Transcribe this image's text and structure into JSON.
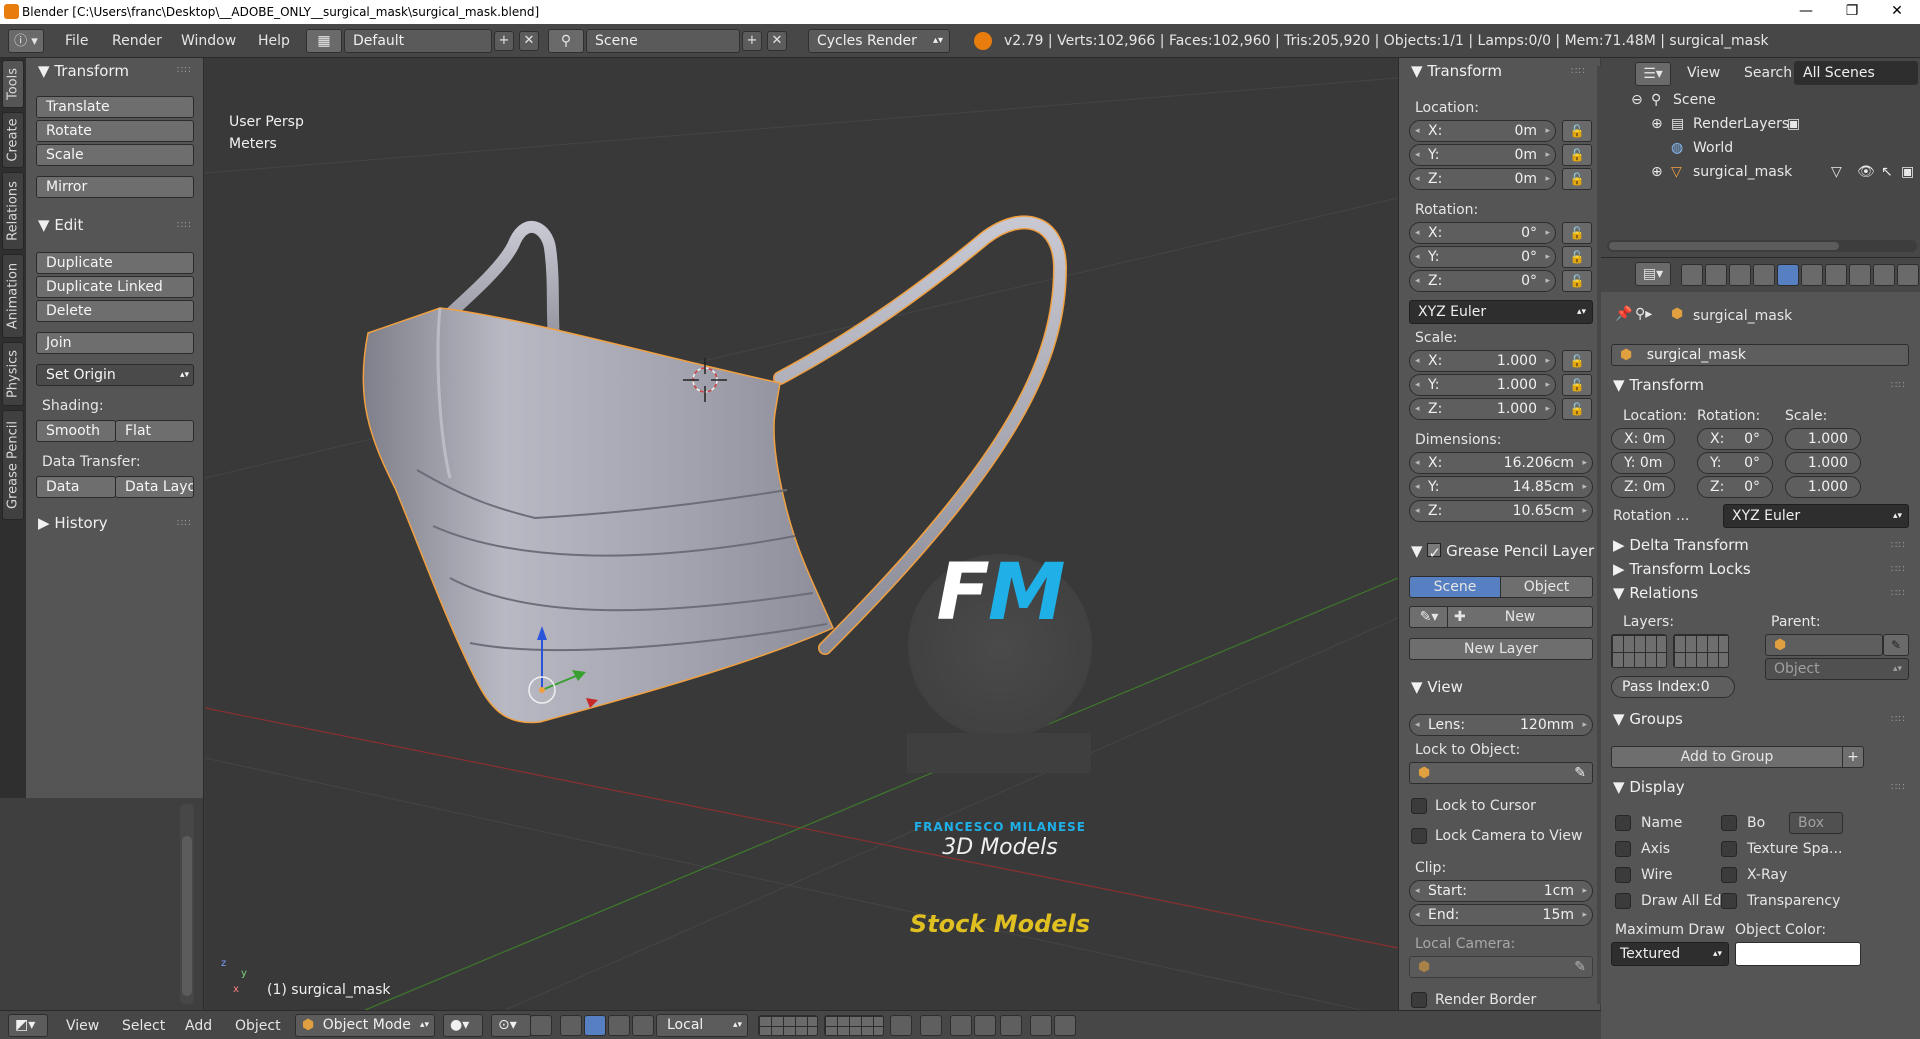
{
  "window": {
    "title": "Blender [C:\\Users\\franc\\Desktop\\__ADOBE_ONLY__surgical_mask\\surgical_mask.blend]",
    "minimize": "—",
    "maximize": "❐",
    "close": "✕"
  },
  "topbar": {
    "menus": [
      "File",
      "Render",
      "Window",
      "Help"
    ],
    "layout": "Default",
    "scene": "Scene",
    "engine": "Cycles Render",
    "stats": "v2.79 | Verts:102,966 | Faces:102,960 | Tris:205,920 | Objects:1/1 | Lamps:0/0 | Mem:71.48M | surgical_mask"
  },
  "tabs": [
    "Tools",
    "Create",
    "Relations",
    "Animation",
    "Physics",
    "Grease Pencil"
  ],
  "toolshelf": {
    "transform_title": "Transform",
    "translate": "Translate",
    "rotate": "Rotate",
    "scale": "Scale",
    "mirror": "Mirror",
    "edit_title": "Edit",
    "duplicate": "Duplicate",
    "duplicate_linked": "Duplicate Linked",
    "delete": "Delete",
    "join": "Join",
    "set_origin": "Set Origin",
    "shading_label": "Shading:",
    "smooth": "Smooth",
    "flat": "Flat",
    "data_transfer_label": "Data Transfer:",
    "data": "Data",
    "data_layout": "Data Layo",
    "history_title": "History"
  },
  "viewport": {
    "view_name": "User Persp",
    "units": "Meters",
    "object_label": "(1) surgical_mask",
    "watermark": {
      "logo_letters": "FM",
      "brand": "FRANCESCO MILANESE",
      "sub": "3D Models",
      "stock": "Stock Models"
    },
    "axis_x": "x",
    "axis_y": "y",
    "axis_z": "z"
  },
  "npanel": {
    "transform_title": "Transform",
    "location_label": "Location:",
    "loc": [
      {
        "axis": "X:",
        "value": "0m"
      },
      {
        "axis": "Y:",
        "value": "0m"
      },
      {
        "axis": "Z:",
        "value": "0m"
      }
    ],
    "rotation_label": "Rotation:",
    "rot": [
      {
        "axis": "X:",
        "value": "0°"
      },
      {
        "axis": "Y:",
        "value": "0°"
      },
      {
        "axis": "Z:",
        "value": "0°"
      }
    ],
    "rotation_mode": "XYZ Euler",
    "scale_label": "Scale:",
    "scale": [
      {
        "axis": "X:",
        "value": "1.000"
      },
      {
        "axis": "Y:",
        "value": "1.000"
      },
      {
        "axis": "Z:",
        "value": "1.000"
      }
    ],
    "dimensions_label": "Dimensions:",
    "dims": [
      {
        "axis": "X:",
        "value": "16.206cm"
      },
      {
        "axis": "Y:",
        "value": "14.85cm"
      },
      {
        "axis": "Z:",
        "value": "10.65cm"
      }
    ],
    "grease_title": "Grease Pencil Layer",
    "scene_btn": "Scene",
    "object_btn": "Object",
    "new_btn": "New",
    "new_layer_btn": "New Layer",
    "view_title": "View",
    "lens_label": "Lens:",
    "lens_value": "120mm",
    "lock_to_object": "Lock to Object:",
    "lock_to_cursor": "Lock to Cursor",
    "lock_camera": "Lock Camera to View",
    "clip_label": "Clip:",
    "clip_start_label": "Start:",
    "clip_start": "1cm",
    "clip_end_label": "End:",
    "clip_end": "15m",
    "local_camera": "Local Camera:",
    "render_border": "Render Border"
  },
  "outliner": {
    "view": "View",
    "search": "Search",
    "filter": "All Scenes",
    "items": [
      {
        "label": "Scene"
      },
      {
        "label": "RenderLayers"
      },
      {
        "label": "World"
      },
      {
        "label": "surgical_mask"
      }
    ]
  },
  "properties": {
    "breadcrumb_object": "surgical_mask",
    "object_name": "surgical_mask",
    "transform_title": "Transform",
    "location_label": "Location:",
    "rotation_label": "Rotation:",
    "scale_label": "Scale:",
    "loc": [
      "X: 0m",
      "Y: 0m",
      "Z: 0m"
    ],
    "rot_axes": [
      "X:",
      "Y:",
      "Z:"
    ],
    "rot_values": [
      "0°",
      "0°",
      "0°"
    ],
    "scale": [
      "1.000",
      "1.000",
      "1.000"
    ],
    "rotation_mode_label": "Rotation ...",
    "rotation_mode": "XYZ Euler",
    "delta_transform": "Delta Transform",
    "transform_locks": "Transform Locks",
    "relations_title": "Relations",
    "layers_label": "Layers:",
    "parent_label": "Parent:",
    "parent_type": "Object",
    "pass_index": "Pass Index:0",
    "groups_title": "Groups",
    "add_to_group": "Add to Group",
    "display_title": "Display",
    "name": "Name",
    "bo": "Bo",
    "box": "Box",
    "axis": "Axis",
    "texture_space": "Texture Spa...",
    "wire": "Wire",
    "xray": "X-Ray",
    "draw_all_edges": "Draw All Ed...",
    "transparency": "Transparency",
    "max_draw": "Maximum Draw",
    "object_color": "Object Color:",
    "max_draw_value": "Textured"
  },
  "bottombar": {
    "view": "View",
    "select": "Select",
    "add": "Add",
    "object": "Object",
    "mode": "Object Mode",
    "orientation": "Local"
  },
  "colors": {
    "accent_blue": "#5680c2",
    "selection_orange": "#f0a040",
    "mask_fill": "#a9a9b6",
    "grid_line": "#464646"
  }
}
